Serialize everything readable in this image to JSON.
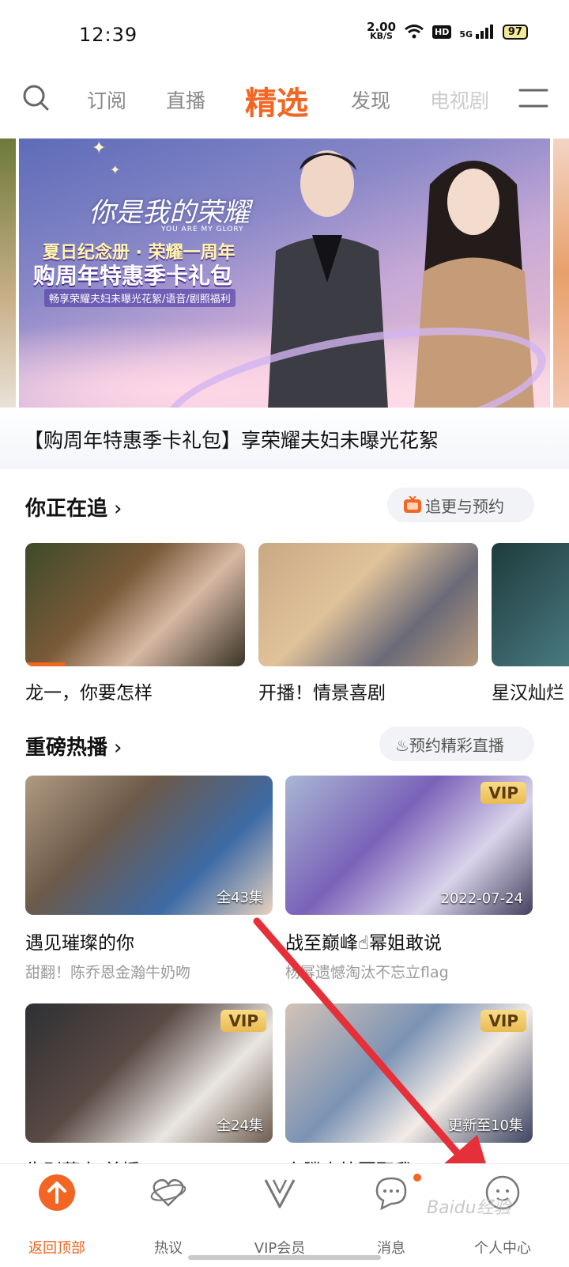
{
  "status_bar": {
    "time": "12:39",
    "net_speed_value": "2.00",
    "net_speed_unit": "KB/S",
    "hd": "HD",
    "signal": "5G",
    "battery": "97"
  },
  "top_nav": {
    "tabs": [
      {
        "label": "订阅"
      },
      {
        "label": "直播"
      },
      {
        "label": "精选",
        "active": true
      },
      {
        "label": "发现"
      },
      {
        "label": "电视剧"
      }
    ],
    "accent_color": "#f26522"
  },
  "banner": {
    "logo_text": "你是我的荣耀",
    "logo_sub": "YOU ARE MY GLORY",
    "line1": "夏日纪念册 · 荣耀一周年",
    "line2": "购周年特惠季卡礼包",
    "line3": "畅享荣耀夫妇未曝光花絮/语音/剧照福利",
    "caption": "【购周年特惠季卡礼包】享荣耀夫妇未曝光花絮"
  },
  "following": {
    "title": "你正在追",
    "chevron": "›",
    "action_label": "追更与预约",
    "items": [
      {
        "title": "龙一，你要怎样",
        "progress": 0.18
      },
      {
        "title": "开播！情景喜剧",
        "progress": 0.0
      },
      {
        "title": "星汉灿烂",
        "progress": 0.0
      }
    ]
  },
  "hot": {
    "title": "重磅热播",
    "chevron": "›",
    "action_label": "♨预约精彩直播",
    "items": [
      {
        "title": "遇见璀璨的你",
        "subtitle": "甜翻！陈乔恩金瀚牛奶吻",
        "overlay": "全43集",
        "vip": ""
      },
      {
        "title": "战至巅峰☝幂姐敢说",
        "subtitle": "杨幂遗憾淘汰不忘立flag",
        "overlay": "2022-07-24",
        "vip": "VIP"
      },
      {
        "title": "告别薇安·首播",
        "subtitle": "",
        "overlay": "全24集",
        "vip": "VIP"
      },
      {
        "title": "奔腾少快要娶我",
        "subtitle": "",
        "overlay": "更新至10集",
        "vip": "VIP"
      }
    ]
  },
  "tab_bar": {
    "tabs": [
      {
        "label": "返回顶部",
        "icon": "arrow-up-icon",
        "active": true
      },
      {
        "label": "热议",
        "icon": "heart-ring-icon"
      },
      {
        "label": "VIP会员",
        "icon": "vip-v-icon"
      },
      {
        "label": "消息",
        "icon": "message-icon",
        "badge_dot": true
      },
      {
        "label": "个人中心",
        "icon": "profile-face-icon"
      }
    ]
  },
  "watermark": "Baidu经验"
}
